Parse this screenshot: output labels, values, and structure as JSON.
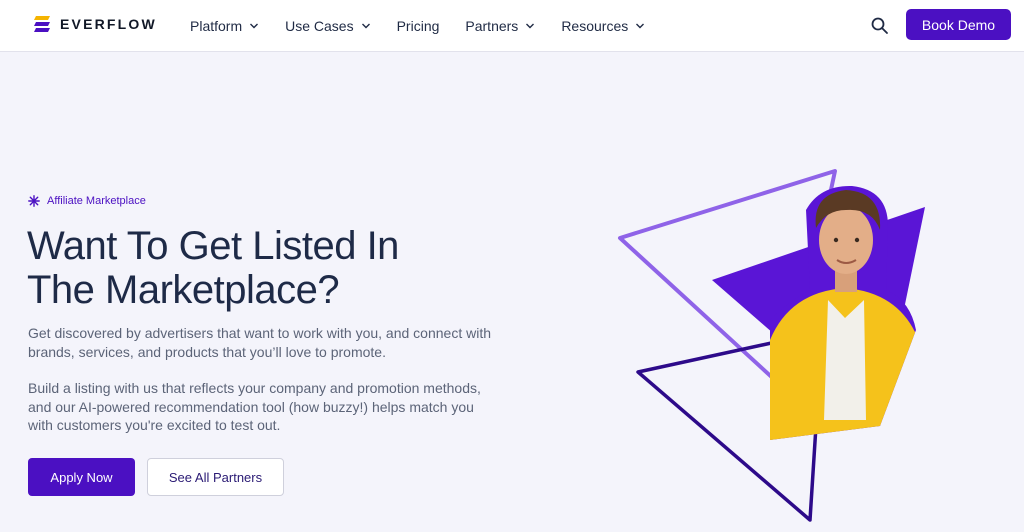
{
  "brand": {
    "name": "EVERFLOW"
  },
  "nav": {
    "items": [
      {
        "label": "Platform",
        "has_dropdown": true
      },
      {
        "label": "Use Cases",
        "has_dropdown": true
      },
      {
        "label": "Pricing",
        "has_dropdown": false
      },
      {
        "label": "Partners",
        "has_dropdown": true
      },
      {
        "label": "Resources",
        "has_dropdown": true
      }
    ],
    "search_icon": "search-icon",
    "cta_label": "Book Demo"
  },
  "hero": {
    "eyebrow": "Affiliate Marketplace",
    "eyebrow_icon": "sparkle-icon",
    "headline_line1": "Want To Get Listed In",
    "headline_line2": "The Marketplace?",
    "paragraph1": "Get discovered by advertisers that want to work with you, and connect with brands, services, and products that you’ll love to promote.",
    "paragraph2": "Build a listing with us that reflects your company and promotion methods, and our AI-powered recommendation tool (how buzzy!) helps match you with customers you're excited to test out.",
    "primary_button": "Apply Now",
    "secondary_button": "See All Partners"
  },
  "colors": {
    "accent": "#4b10c2",
    "accent_light": "#8f63e8",
    "background": "#f4f4fb",
    "heading": "#1e2a47",
    "body_text": "#5c6478",
    "jacket": "#f5c21b"
  }
}
